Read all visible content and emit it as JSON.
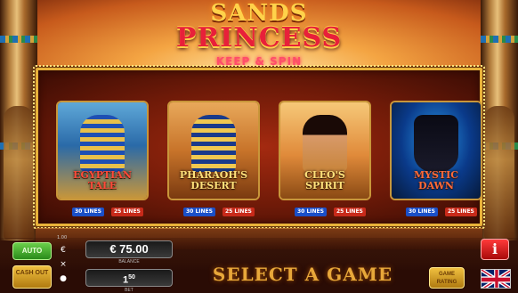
{
  "title": {
    "line1": "SANDS",
    "line2": "PRINCESS",
    "tagline": "KEEP & SPIN"
  },
  "games": [
    {
      "name": "EGYPTIAN TALE",
      "lines_a": "30 LINES",
      "lines_b": "25 LINES"
    },
    {
      "name": "PHARAOH'S DESERT",
      "lines_a": "30 LINES",
      "lines_b": "25 LINES"
    },
    {
      "name": "CLEO'S SPIRIT",
      "lines_a": "30 LINES",
      "lines_b": "25 LINES"
    },
    {
      "name": "MYSTIC DAWN",
      "lines_a": "30 LINES",
      "lines_b": "25 LINES"
    }
  ],
  "controls": {
    "auto_label": "AUTO",
    "cashout_label": "CASH OUT",
    "credit_value": "€ 75.00",
    "credit_label": "BALANCE",
    "bet_value": "1",
    "bet_value_sup": "50",
    "bet_label": "BET",
    "currency_symbol": "€",
    "x_symbol": "×",
    "small_mark": "1.00",
    "select_game_label": "SELECT A GAME",
    "info_label": "i",
    "rating_label": "GAME RATING",
    "language_icon": "uk-flag-icon"
  },
  "colors": {
    "accent_gold": "#e8b23a",
    "accent_red": "#e8203a",
    "auto_green": "#2a8a1a",
    "info_red": "#a80a0a"
  }
}
